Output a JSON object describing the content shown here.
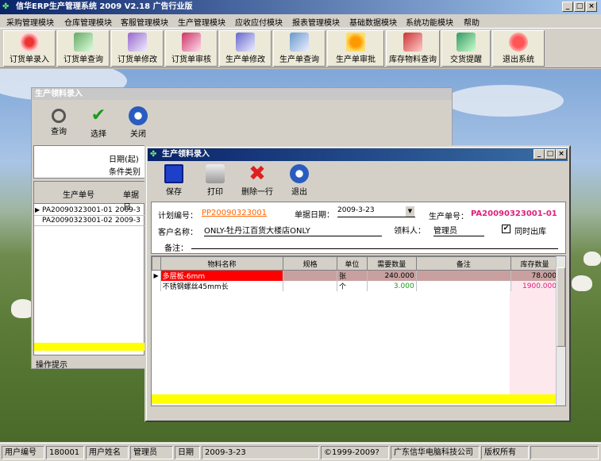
{
  "app": {
    "title": "信华ERP生产管理系统  2009 V2.18 广告行业版"
  },
  "menu": [
    "采购管理模块",
    "仓库管理模块",
    "客服管理模块",
    "生产管理模块",
    "应收应付模块",
    "报表管理模块",
    "基础数据模块",
    "系统功能模块",
    "帮助"
  ],
  "toolbar": [
    "订货单录入",
    "订货单查询",
    "订货单修改",
    "订货单审核",
    "生产单修改",
    "生产单查询",
    "生产单审批",
    "库存物料查询",
    "交货提醒",
    "退出系统"
  ],
  "back_window": {
    "title": "生产领料录入",
    "buttons": [
      "查询",
      "选择",
      "关闭"
    ],
    "date_label": "日期(起)",
    "condition_label": "条件类别",
    "columns": [
      "生产单号",
      "单据日"
    ],
    "rows": [
      [
        "PA20090323001-01",
        "2009-3"
      ],
      [
        "PA20090323001-02",
        "2009-3"
      ]
    ],
    "hint_tab": "操作提示"
  },
  "front_window": {
    "title": "生产领料录入",
    "buttons": [
      "保存",
      "打印",
      "删除一行",
      "退出"
    ],
    "plan_no_label": "计划编号：",
    "plan_no": "PP20090323001",
    "doc_date_label": "单据日期：",
    "doc_date": "2009-3-23",
    "prod_no_label": "生产单号：",
    "prod_no": "PA20090323001-01",
    "customer_label": "客户名称：",
    "customer": "ONLY-牡丹江百货大楼店ONLY",
    "receiver_label": "领料人：",
    "receiver": "管理员",
    "same_out_label": "同时出库",
    "same_out_checked": "✔",
    "note_label": "备注：",
    "columns": [
      "物料名称",
      "规格",
      "单位",
      "需要数量",
      "备注",
      "库存数量"
    ],
    "rows": [
      [
        "多层板-6mm",
        "",
        "张",
        "240.000",
        "",
        "78.000"
      ],
      [
        "不锈钢螺丝45mm长",
        "",
        "个",
        "3.000",
        "",
        "1900.000"
      ]
    ]
  },
  "statusbar": {
    "user_no_label": "用户编号",
    "user_no": "180001",
    "user_name_label": "用户姓名",
    "user_name": "管理员",
    "date_label": "日期",
    "date": "2009-3-23",
    "copyright": "©1999-2009?",
    "company": "广东信华电脑科技公司",
    "rights": "版权所有"
  }
}
